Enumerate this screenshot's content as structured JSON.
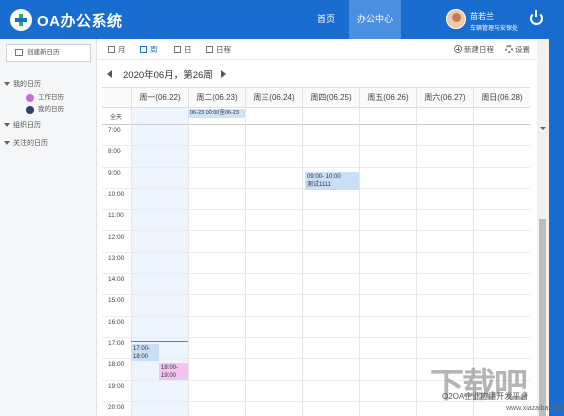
{
  "header": {
    "app_title": "OA办公系统",
    "nav": [
      "首页",
      "办公中心"
    ],
    "user_name": "苗若兰",
    "user_dept": "车辆管理与安保处"
  },
  "sidebar": {
    "new_calendar": "创建新日历",
    "my_calendar": "我的日历",
    "sub_items": [
      {
        "label": "工作日历",
        "color": "#c46fd6"
      },
      {
        "label": "我的日历",
        "color": "#2d3f6b"
      }
    ],
    "org_calendar": "组织日历",
    "followed_calendar": "关注的日历"
  },
  "toolbar": {
    "views": [
      "月",
      "周",
      "日",
      "日程"
    ],
    "new_event": "新建日程",
    "settings": "设置"
  },
  "calendar": {
    "week_label": "2020年06月，第26周",
    "days": [
      "周一(06.22)",
      "周二(06.23)",
      "周三(06.24)",
      "周四(06.25)",
      "周五(06.26)",
      "周六(06.27)",
      "周日(06.28)"
    ],
    "allday_label": "全天",
    "hours": [
      "7:00",
      "8:00",
      "9:00",
      "10:00",
      "11:00",
      "12:00",
      "13:00",
      "14:00",
      "15:00",
      "16:00",
      "17:00",
      "18:00",
      "19:00",
      "20:00"
    ],
    "events": {
      "allday_text": "06-23 00:00至06-23",
      "meeting_time": "09:00- 10:00",
      "meeting_title": "测试1111",
      "seven_time_a": "17:00-",
      "seven_time_b": "18:00",
      "eight_time_a": "18:00-",
      "eight_time_b": "19:00"
    }
  },
  "watermark": {
    "main": "下载吧",
    "sub1": "O2OA企业应用开发平台",
    "sub2": "www.xiazaiba.com"
  }
}
